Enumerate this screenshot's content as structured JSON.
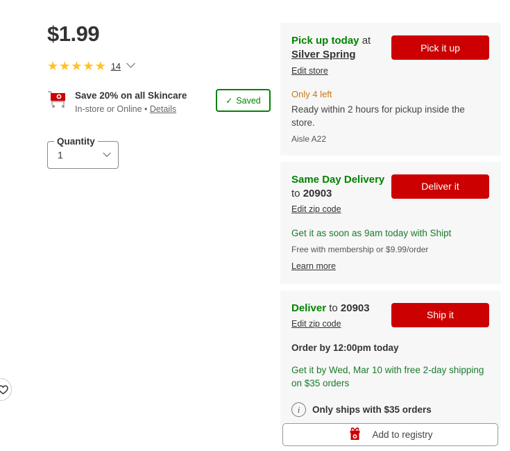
{
  "product": {
    "price": "$1.99",
    "rating_stars": 5,
    "rating_count": "14",
    "star_color": "#ffc220"
  },
  "promo": {
    "icon": "cart-icon",
    "title": "Save 20% on all Skincare",
    "subtitle_prefix": "In-store or Online • ",
    "details_label": "Details"
  },
  "saved_button": {
    "label": "Saved",
    "check": "✓",
    "color": "#008300"
  },
  "quantity": {
    "legend": "Quantity",
    "value": "1"
  },
  "favorite": {
    "icon": "heart-icon"
  },
  "fulfillment": [
    {
      "id": "pickup",
      "head_green": "Pick up today",
      "head_mid": " at ",
      "head_bold": "Silver Spring",
      "edit_link": "Edit store",
      "button_label": "Pick it up",
      "stock_warning": "Only 4 left",
      "detail": "Ready within 2 hours for pickup inside the store.",
      "aisle": "Aisle A22"
    },
    {
      "id": "same-day-delivery",
      "head_green": "Same Day Delivery",
      "head_mid": " to ",
      "head_bold": "20903",
      "edit_link": "Edit zip code",
      "button_label": "Deliver it",
      "eta": "Get it as soon as 9am today with Shipt",
      "fee": "Free with membership or $9.99/order",
      "learn_more": "Learn more"
    },
    {
      "id": "shipping",
      "head_green": "Deliver",
      "head_mid": " to ",
      "head_bold": "20903",
      "edit_link": "Edit zip code",
      "button_label": "Ship it",
      "order_by": "Order by 12:00pm today",
      "eta": "Get it by Wed, Mar 10 with free 2-day shipping on $35 orders",
      "ships_note": "Only ships with $35 orders",
      "info_icon": "info-icon"
    }
  ],
  "registry": {
    "label": "Add to registry",
    "icon": "gift-icon"
  },
  "colors": {
    "brand_red": "#cc0000",
    "green": "#008300",
    "warn_orange": "#c8781a",
    "card_bg": "#f7f7f7"
  }
}
